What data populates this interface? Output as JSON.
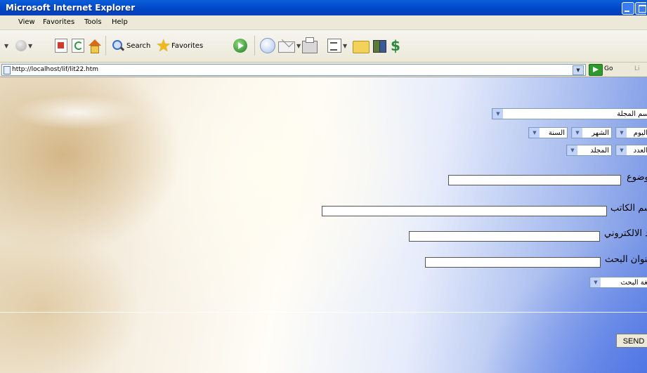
{
  "window": {
    "title": "Microsoft Internet Explorer"
  },
  "menubar": {
    "items": [
      "View",
      "Favorites",
      "Tools",
      "Help"
    ]
  },
  "toolbar": {
    "search_label": "Search",
    "favorites_label": "Favorites"
  },
  "addressbar": {
    "url": "http://localhost/lif/lit22.htm",
    "go_label": "Go",
    "links_label": "Li"
  },
  "form": {
    "magazine_select": "اسم المجلة",
    "day_select": "اليوم",
    "month_select": "الشهر",
    "year_select": "السنة",
    "issue_select": "العدد",
    "volume_select": "المجلد",
    "topic_label": "الموضوع",
    "author_label": "اسم الكاتب",
    "email_label": "البريد الالكتروني",
    "search_title_label": "عنوان البحث",
    "language_select": "لغة البحث",
    "send_label": "SEND"
  }
}
